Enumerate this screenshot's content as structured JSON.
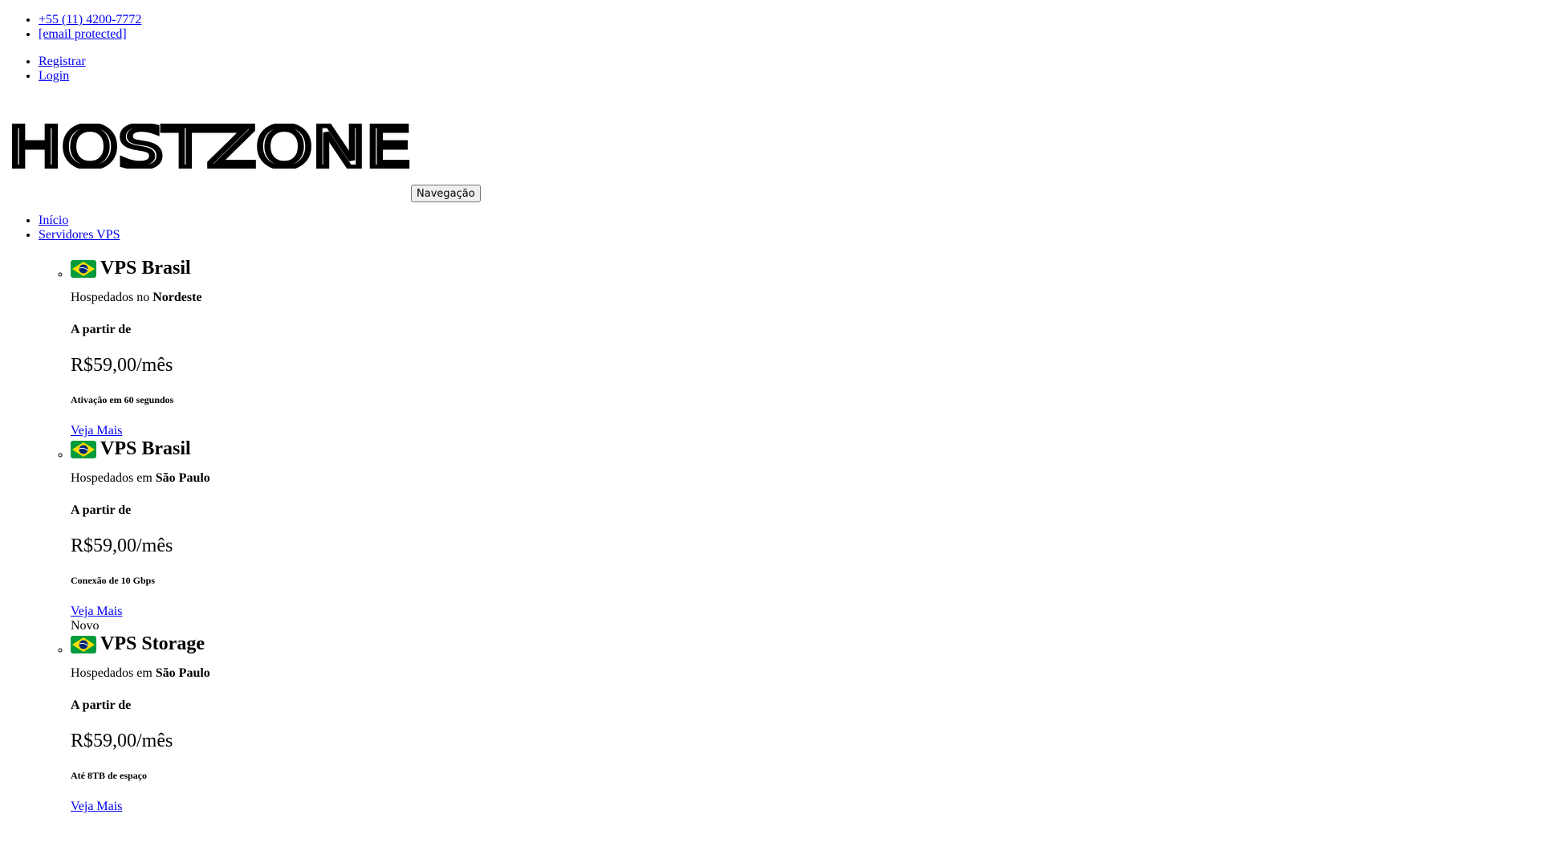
{
  "contact": {
    "phone": "+55 (11) 4200-7772",
    "email": "[email protected]"
  },
  "account": {
    "register": "Registrar",
    "login": "Login"
  },
  "logo_text": "HOSTZONE",
  "nav_button": "Navegação",
  "menu": {
    "home": "Início",
    "vps": "Servidores VPS"
  },
  "cards": [
    {
      "title": "VPS Brasil",
      "host_prefix": "Hospedados no",
      "host_location": "Nordeste",
      "from_label": "A partir de",
      "price": "R$59,00/mês",
      "feature": "Ativação em 60 segundos",
      "more": "Veja Mais"
    },
    {
      "title": "VPS Brasil",
      "host_prefix": "Hospedados em",
      "host_location": "São Paulo",
      "from_label": "A partir de",
      "price": "R$59,00/mês",
      "feature": "Conexão de 10 Gbps",
      "more": "Veja Mais",
      "badge": "Novo"
    },
    {
      "title": "VPS Storage",
      "host_prefix": "Hospedados em",
      "host_location": "São Paulo",
      "from_label": "A partir de",
      "price": "R$59,00/mês",
      "feature": "Até 8TB de espaço",
      "more": "Veja Mais"
    }
  ],
  "colors": {
    "link": "#0000ee",
    "flag_green": "#009b3a",
    "flag_yellow": "#fedf00",
    "flag_blue": "#002776"
  }
}
